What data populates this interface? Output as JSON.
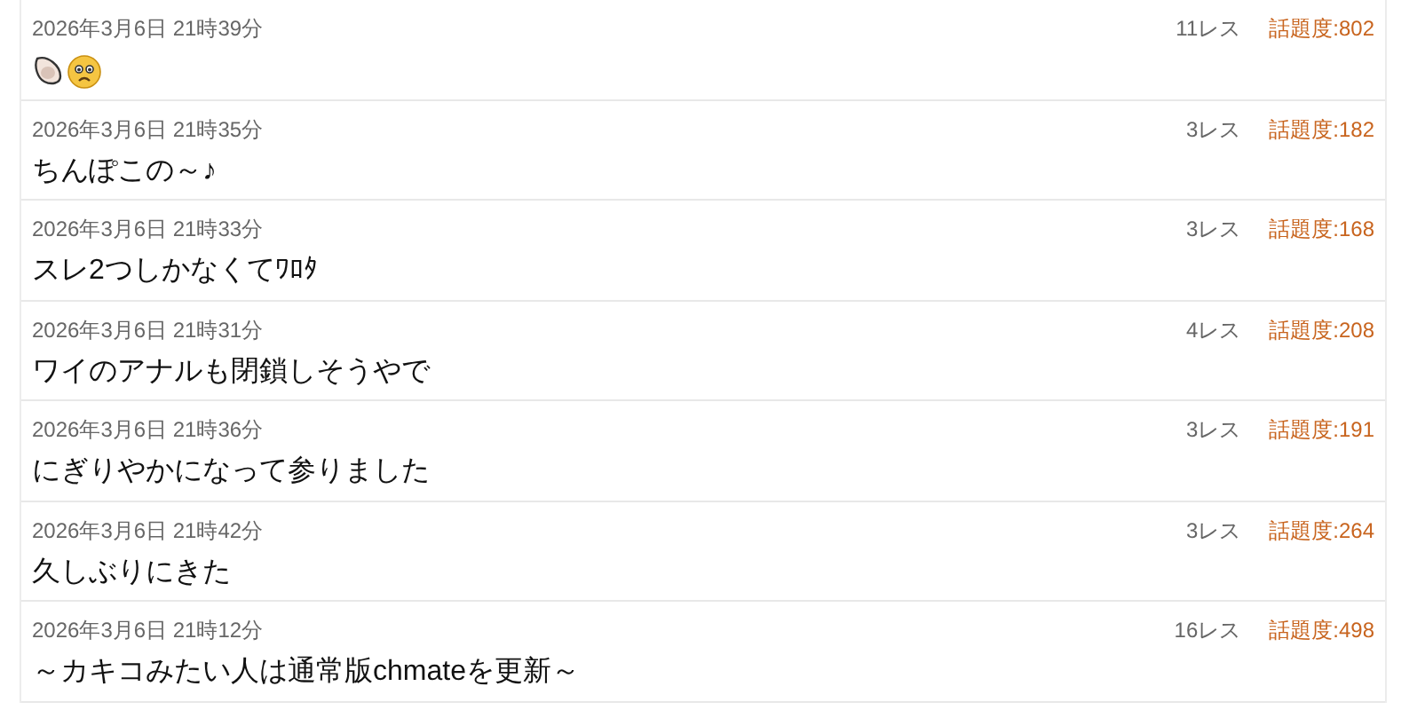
{
  "threads": [
    {
      "date": "2026年3月6日 21時39分",
      "res": "11レス",
      "score": "話題度:802",
      "kind": "emoji"
    },
    {
      "date": "2026年3月6日 21時35分",
      "res": "3レス",
      "score": "話題度:182",
      "kind": "text",
      "title": "ちんぽこの～♪"
    },
    {
      "date": "2026年3月6日 21時33分",
      "res": "3レス",
      "score": "話題度:168",
      "kind": "text",
      "title": "スレ2つしかなくてﾜﾛﾀ"
    },
    {
      "date": "2026年3月6日 21時31分",
      "res": "4レス",
      "score": "話題度:208",
      "kind": "text",
      "title": "ワイのアナルも閉鎖しそうやで"
    },
    {
      "date": "2026年3月6日 21時36分",
      "res": "3レス",
      "score": "話題度:191",
      "kind": "text",
      "title": "にぎりやかになって参りました"
    },
    {
      "date": "2026年3月6日 21時42分",
      "res": "3レス",
      "score": "話題度:264",
      "kind": "text",
      "title": "久しぶりにきた"
    },
    {
      "date": "2026年3月6日 21時12分",
      "res": "16レス",
      "score": "話題度:498",
      "kind": "text",
      "title": "～カキコみたい人は通常版chmateを更新～"
    }
  ]
}
